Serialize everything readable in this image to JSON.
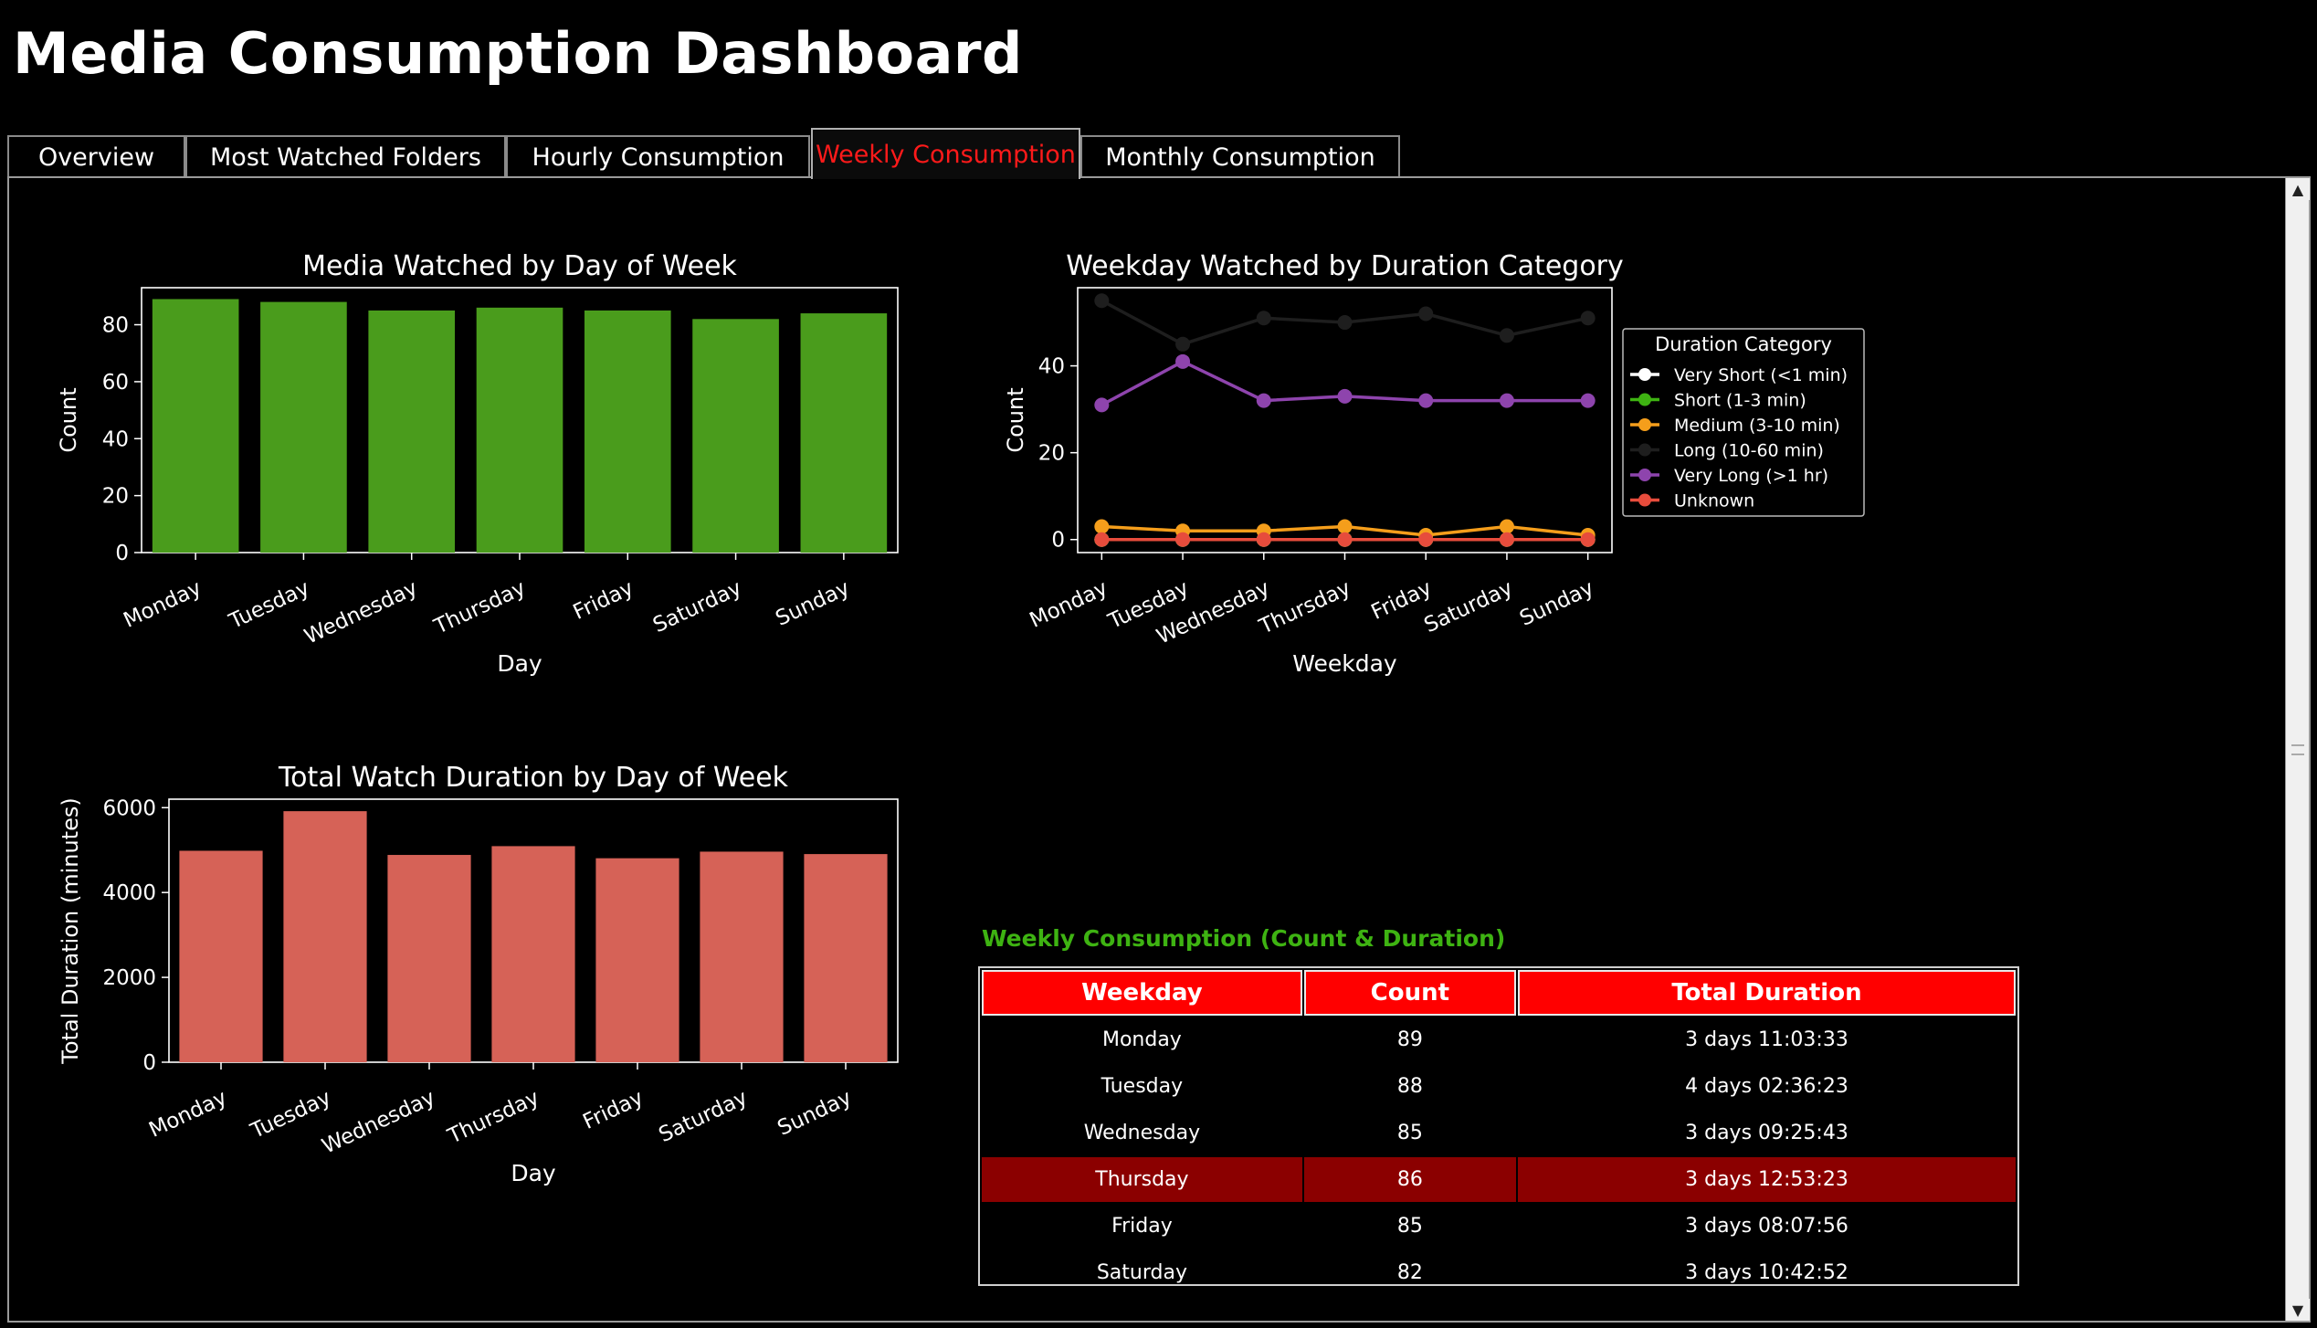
{
  "app": {
    "title": "Media Consumption Dashboard"
  },
  "tabs": [
    {
      "label": "Overview",
      "active": false
    },
    {
      "label": "Most Watched Folders",
      "active": false
    },
    {
      "label": "Hourly Consumption",
      "active": false
    },
    {
      "label": "Weekly Consumption",
      "active": true
    },
    {
      "label": "Monthly Consumption",
      "active": false
    }
  ],
  "colors": {
    "accent_active_tab": "#ff1a1a",
    "bar_green": "#4a9c1c",
    "bar_red": "#d66257",
    "table_header": "#ff0000",
    "table_selected_row": "#8b0000",
    "table_caption": "#3eb312"
  },
  "scrollbar": {
    "up_icon": "arrow-up-icon",
    "down_icon": "arrow-down-icon"
  },
  "chart_data": [
    {
      "id": "day-count",
      "type": "bar",
      "title": "Media Watched by Day of Week",
      "xlabel": "Day",
      "ylabel": "Count",
      "categories": [
        "Monday",
        "Tuesday",
        "Wednesday",
        "Thursday",
        "Friday",
        "Saturday",
        "Sunday"
      ],
      "values": [
        89,
        88,
        85,
        86,
        85,
        82,
        84
      ],
      "ylim": [
        0,
        93
      ],
      "yticks": [
        "0",
        "20",
        "40",
        "60",
        "80"
      ],
      "color": "#4a9c1c",
      "grid": false
    },
    {
      "id": "duration-category",
      "type": "line",
      "title": "Weekday Watched by Duration Category",
      "xlabel": "Weekday",
      "ylabel": "Count",
      "categories": [
        "Monday",
        "Tuesday",
        "Wednesday",
        "Thursday",
        "Friday",
        "Saturday",
        "Sunday"
      ],
      "ylim": [
        -3,
        58
      ],
      "yticks": [
        "0",
        "20",
        "40"
      ],
      "legend_title": "Duration Category",
      "legend_position": "outside-right-top",
      "series": [
        {
          "name": "Very Short (<1 min)",
          "color": "#ffffff",
          "values": [
            0,
            0,
            0,
            0,
            0,
            0,
            0
          ]
        },
        {
          "name": "Short (1-3 min)",
          "color": "#3eb312",
          "values": [
            0,
            0,
            0,
            0,
            0,
            0,
            0
          ]
        },
        {
          "name": "Medium (3-10 min)",
          "color": "#f59e1b",
          "values": [
            3,
            2,
            2,
            3,
            1,
            3,
            1
          ]
        },
        {
          "name": "Long (10-60 min)",
          "color": "#1e1e1e",
          "values": [
            55,
            45,
            51,
            50,
            52,
            47,
            51
          ]
        },
        {
          "name": "Very Long (>1 hr)",
          "color": "#8e44ad",
          "values": [
            31,
            41,
            32,
            33,
            32,
            32,
            32
          ]
        },
        {
          "name": "Unknown",
          "color": "#e74c3c",
          "values": [
            0,
            0,
            0,
            0,
            0,
            0,
            0
          ]
        }
      ]
    },
    {
      "id": "day-duration",
      "type": "bar",
      "title": "Total Watch Duration by Day of Week",
      "xlabel": "Day",
      "ylabel": "Total Duration (minutes)",
      "categories": [
        "Monday",
        "Tuesday",
        "Wednesday",
        "Thursday",
        "Friday",
        "Saturday",
        "Sunday"
      ],
      "values": [
        4984,
        5917,
        4886,
        5093,
        4808,
        4963,
        4906
      ],
      "ylim": [
        0,
        6200
      ],
      "yticks": [
        "0",
        "2000",
        "4000",
        "6000"
      ],
      "color": "#d66257",
      "grid": false
    }
  ],
  "weekly_table": {
    "caption": "Weekly Consumption (Count & Duration)",
    "columns": [
      "Weekday",
      "Count",
      "Total Duration"
    ],
    "selected_row": 3,
    "rows": [
      [
        "Monday",
        "89",
        "3 days 11:03:33"
      ],
      [
        "Tuesday",
        "88",
        "4 days 02:36:23"
      ],
      [
        "Wednesday",
        "85",
        "3 days 09:25:43"
      ],
      [
        "Thursday",
        "86",
        "3 days 12:53:23"
      ],
      [
        "Friday",
        "85",
        "3 days 08:07:56"
      ],
      [
        "Saturday",
        "82",
        "3 days 10:42:52"
      ]
    ]
  }
}
